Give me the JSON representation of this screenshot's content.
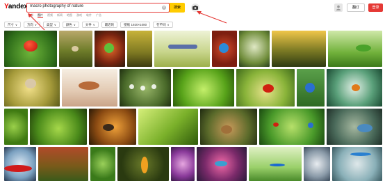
{
  "brand": {
    "logo_y": "Y",
    "logo_rest": "andex"
  },
  "search": {
    "query": "macro photography of nature",
    "button_label": "搜索"
  },
  "header": {
    "secondary_button": "翻订",
    "primary_button": "登录"
  },
  "tabs": [
    "全部",
    "图片",
    "视频",
    "新闻",
    "地图",
    "游戏",
    "软件",
    "广告"
  ],
  "filters": [
    {
      "label": "尺寸",
      "caret": "∨"
    },
    {
      "label": "方向",
      "caret": "∨"
    },
    {
      "label": "类型",
      "caret": "∨"
    },
    {
      "label": "颜色",
      "caret": "∨"
    },
    {
      "label": "文件",
      "caret": "∨"
    },
    {
      "label": "最近的",
      "caret": ""
    },
    {
      "label": "壁纸 1920×1080",
      "caret": ""
    },
    {
      "label": "在不同",
      "caret": "∨"
    }
  ],
  "colors": {
    "accent_red": "#e53935",
    "search_button": "#ffcc00"
  },
  "icons": {
    "camera": "camera-icon",
    "user": "user-icon",
    "clear": "clear-icon"
  }
}
